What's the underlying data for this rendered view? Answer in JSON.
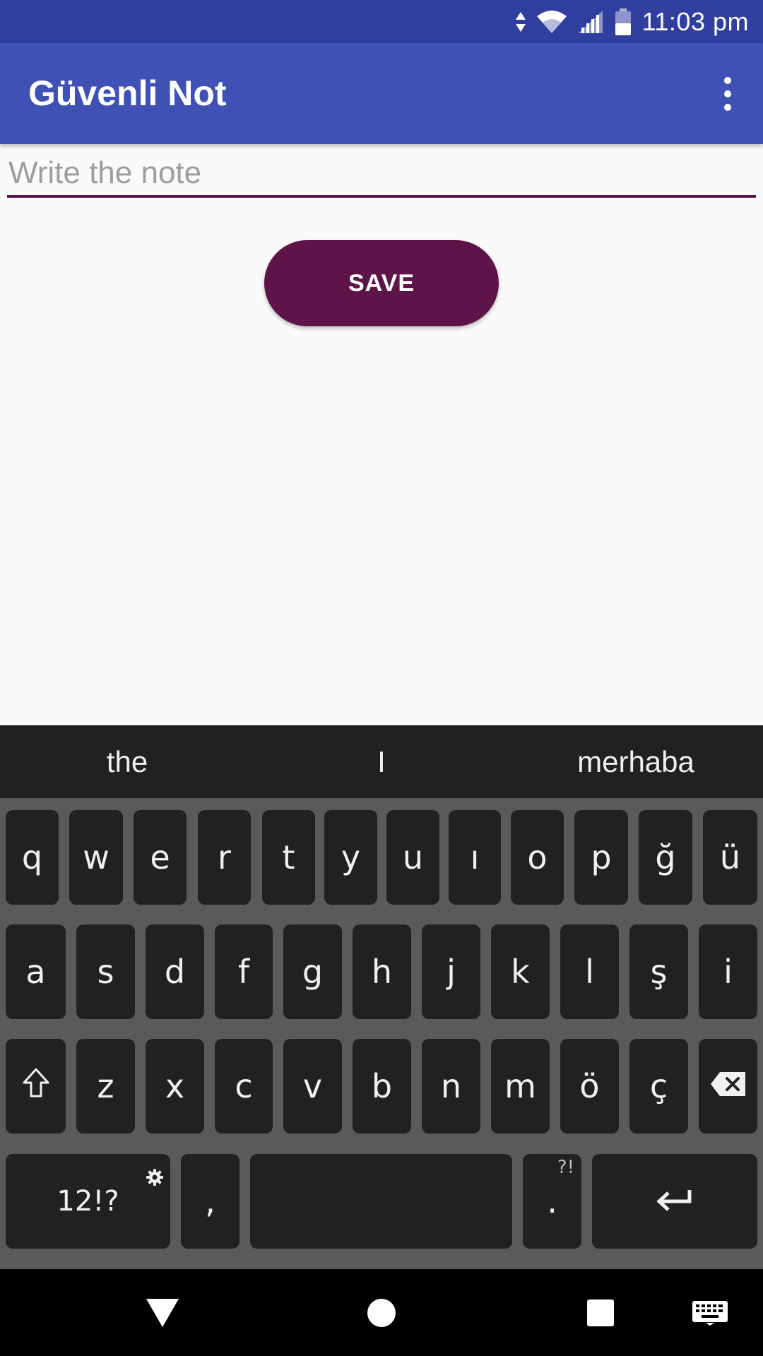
{
  "status_bar": {
    "time": "11:03 pm",
    "icons": [
      "data-arrows-icon",
      "wifi-icon",
      "cell-signal-icon",
      "battery-icon"
    ]
  },
  "app_bar": {
    "title": "Güvenli Not",
    "menu_icon": "overflow-menu-icon"
  },
  "editor": {
    "placeholder": "Write the note",
    "value": ""
  },
  "save_button": {
    "label": "SAVE"
  },
  "colors": {
    "status_bar": "#303f9f",
    "app_bar": "#3f51b5",
    "accent": "#5e1449",
    "keyboard_key": "#212121",
    "keyboard_bg": "#5a5a5a"
  },
  "keyboard": {
    "suggestions": [
      "the",
      "I",
      "merhaba"
    ],
    "row1": [
      "q",
      "w",
      "e",
      "r",
      "t",
      "y",
      "u",
      "ı",
      "o",
      "p",
      "ğ",
      "ü"
    ],
    "row2": [
      "a",
      "s",
      "d",
      "f",
      "g",
      "h",
      "j",
      "k",
      "l",
      "ş",
      "i"
    ],
    "row3": [
      "z",
      "x",
      "c",
      "v",
      "b",
      "n",
      "m",
      "ö",
      "ç"
    ],
    "symbols_label": "12!?",
    "symbols_icon": "gear-icon",
    "comma_label": ",",
    "period_label": ".",
    "period_hint": "?!",
    "shift_icon": "shift-icon",
    "backspace_icon": "backspace-icon",
    "enter_icon": "enter-icon"
  },
  "nav_bar": {
    "icons": [
      "back-icon",
      "home-icon",
      "recents-icon",
      "keyboard-switch-icon"
    ]
  }
}
